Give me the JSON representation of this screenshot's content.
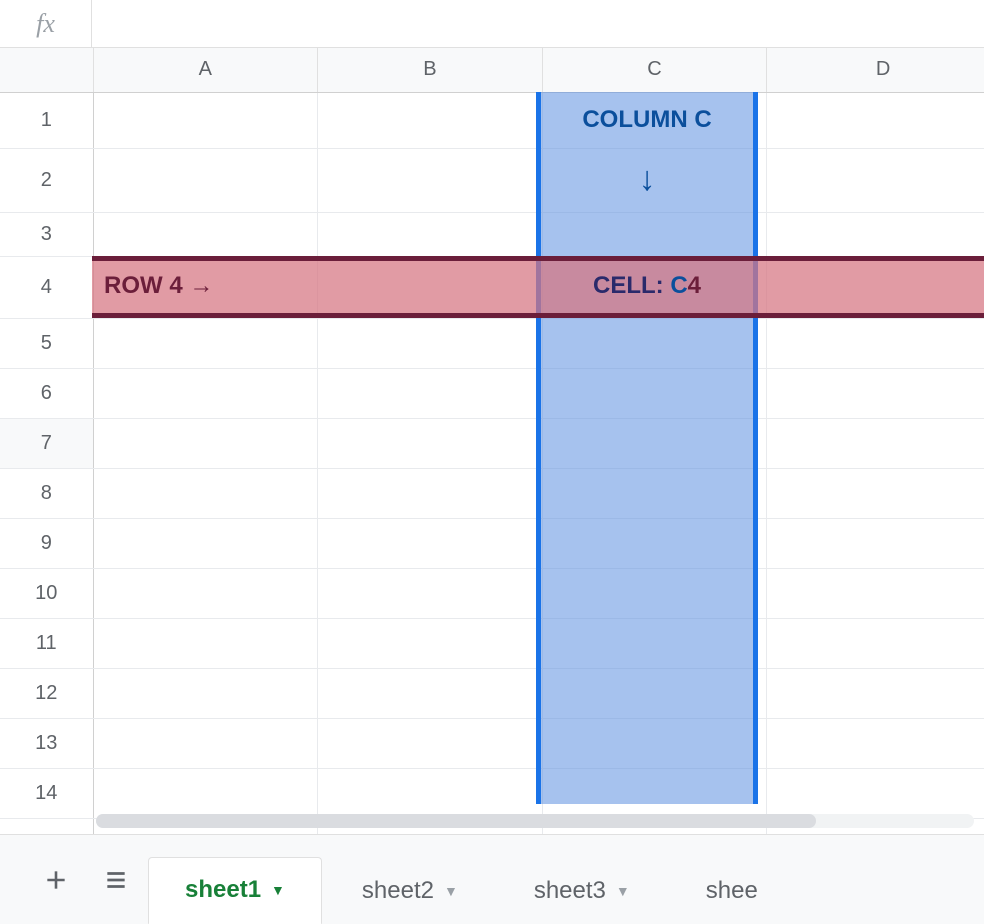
{
  "formula_bar": {
    "fx_label": "fx",
    "value": ""
  },
  "columns": [
    "A",
    "B",
    "C",
    "D"
  ],
  "rows": [
    "1",
    "2",
    "3",
    "4",
    "5",
    "6",
    "7",
    "8",
    "9",
    "10",
    "11",
    "12",
    "13",
    "14"
  ],
  "overlay": {
    "column_label": "COLUMN C",
    "row_label": "ROW 4 →",
    "cell_label_prefix": "CELL: ",
    "cell_ref_col": "C",
    "cell_ref_row": "4",
    "down_arrow": "↓"
  },
  "tabs": {
    "add_tooltip": "Add sheet",
    "allsheets_tooltip": "All sheets",
    "items": [
      {
        "label": "sheet1",
        "active": true
      },
      {
        "label": "sheet2",
        "active": false
      },
      {
        "label": "sheet3",
        "active": false
      },
      {
        "label": "shee",
        "active": false,
        "cut": true
      }
    ]
  }
}
